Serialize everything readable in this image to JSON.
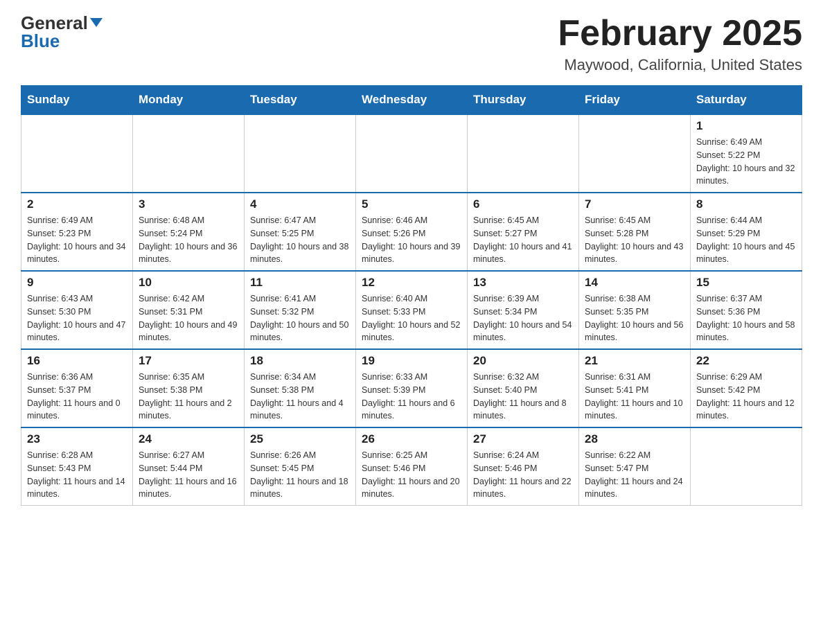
{
  "logo": {
    "general": "General",
    "arrow": "▶",
    "blue": "Blue"
  },
  "header": {
    "month_title": "February 2025",
    "location": "Maywood, California, United States"
  },
  "days_of_week": [
    "Sunday",
    "Monday",
    "Tuesday",
    "Wednesday",
    "Thursday",
    "Friday",
    "Saturday"
  ],
  "weeks": [
    {
      "days": [
        {
          "day": "",
          "sunrise": "",
          "sunset": "",
          "daylight": ""
        },
        {
          "day": "",
          "sunrise": "",
          "sunset": "",
          "daylight": ""
        },
        {
          "day": "",
          "sunrise": "",
          "sunset": "",
          "daylight": ""
        },
        {
          "day": "",
          "sunrise": "",
          "sunset": "",
          "daylight": ""
        },
        {
          "day": "",
          "sunrise": "",
          "sunset": "",
          "daylight": ""
        },
        {
          "day": "",
          "sunrise": "",
          "sunset": "",
          "daylight": ""
        },
        {
          "day": "1",
          "sunrise": "Sunrise: 6:49 AM",
          "sunset": "Sunset: 5:22 PM",
          "daylight": "Daylight: 10 hours and 32 minutes."
        }
      ]
    },
    {
      "days": [
        {
          "day": "2",
          "sunrise": "Sunrise: 6:49 AM",
          "sunset": "Sunset: 5:23 PM",
          "daylight": "Daylight: 10 hours and 34 minutes."
        },
        {
          "day": "3",
          "sunrise": "Sunrise: 6:48 AM",
          "sunset": "Sunset: 5:24 PM",
          "daylight": "Daylight: 10 hours and 36 minutes."
        },
        {
          "day": "4",
          "sunrise": "Sunrise: 6:47 AM",
          "sunset": "Sunset: 5:25 PM",
          "daylight": "Daylight: 10 hours and 38 minutes."
        },
        {
          "day": "5",
          "sunrise": "Sunrise: 6:46 AM",
          "sunset": "Sunset: 5:26 PM",
          "daylight": "Daylight: 10 hours and 39 minutes."
        },
        {
          "day": "6",
          "sunrise": "Sunrise: 6:45 AM",
          "sunset": "Sunset: 5:27 PM",
          "daylight": "Daylight: 10 hours and 41 minutes."
        },
        {
          "day": "7",
          "sunrise": "Sunrise: 6:45 AM",
          "sunset": "Sunset: 5:28 PM",
          "daylight": "Daylight: 10 hours and 43 minutes."
        },
        {
          "day": "8",
          "sunrise": "Sunrise: 6:44 AM",
          "sunset": "Sunset: 5:29 PM",
          "daylight": "Daylight: 10 hours and 45 minutes."
        }
      ]
    },
    {
      "days": [
        {
          "day": "9",
          "sunrise": "Sunrise: 6:43 AM",
          "sunset": "Sunset: 5:30 PM",
          "daylight": "Daylight: 10 hours and 47 minutes."
        },
        {
          "day": "10",
          "sunrise": "Sunrise: 6:42 AM",
          "sunset": "Sunset: 5:31 PM",
          "daylight": "Daylight: 10 hours and 49 minutes."
        },
        {
          "day": "11",
          "sunrise": "Sunrise: 6:41 AM",
          "sunset": "Sunset: 5:32 PM",
          "daylight": "Daylight: 10 hours and 50 minutes."
        },
        {
          "day": "12",
          "sunrise": "Sunrise: 6:40 AM",
          "sunset": "Sunset: 5:33 PM",
          "daylight": "Daylight: 10 hours and 52 minutes."
        },
        {
          "day": "13",
          "sunrise": "Sunrise: 6:39 AM",
          "sunset": "Sunset: 5:34 PM",
          "daylight": "Daylight: 10 hours and 54 minutes."
        },
        {
          "day": "14",
          "sunrise": "Sunrise: 6:38 AM",
          "sunset": "Sunset: 5:35 PM",
          "daylight": "Daylight: 10 hours and 56 minutes."
        },
        {
          "day": "15",
          "sunrise": "Sunrise: 6:37 AM",
          "sunset": "Sunset: 5:36 PM",
          "daylight": "Daylight: 10 hours and 58 minutes."
        }
      ]
    },
    {
      "days": [
        {
          "day": "16",
          "sunrise": "Sunrise: 6:36 AM",
          "sunset": "Sunset: 5:37 PM",
          "daylight": "Daylight: 11 hours and 0 minutes."
        },
        {
          "day": "17",
          "sunrise": "Sunrise: 6:35 AM",
          "sunset": "Sunset: 5:38 PM",
          "daylight": "Daylight: 11 hours and 2 minutes."
        },
        {
          "day": "18",
          "sunrise": "Sunrise: 6:34 AM",
          "sunset": "Sunset: 5:38 PM",
          "daylight": "Daylight: 11 hours and 4 minutes."
        },
        {
          "day": "19",
          "sunrise": "Sunrise: 6:33 AM",
          "sunset": "Sunset: 5:39 PM",
          "daylight": "Daylight: 11 hours and 6 minutes."
        },
        {
          "day": "20",
          "sunrise": "Sunrise: 6:32 AM",
          "sunset": "Sunset: 5:40 PM",
          "daylight": "Daylight: 11 hours and 8 minutes."
        },
        {
          "day": "21",
          "sunrise": "Sunrise: 6:31 AM",
          "sunset": "Sunset: 5:41 PM",
          "daylight": "Daylight: 11 hours and 10 minutes."
        },
        {
          "day": "22",
          "sunrise": "Sunrise: 6:29 AM",
          "sunset": "Sunset: 5:42 PM",
          "daylight": "Daylight: 11 hours and 12 minutes."
        }
      ]
    },
    {
      "days": [
        {
          "day": "23",
          "sunrise": "Sunrise: 6:28 AM",
          "sunset": "Sunset: 5:43 PM",
          "daylight": "Daylight: 11 hours and 14 minutes."
        },
        {
          "day": "24",
          "sunrise": "Sunrise: 6:27 AM",
          "sunset": "Sunset: 5:44 PM",
          "daylight": "Daylight: 11 hours and 16 minutes."
        },
        {
          "day": "25",
          "sunrise": "Sunrise: 6:26 AM",
          "sunset": "Sunset: 5:45 PM",
          "daylight": "Daylight: 11 hours and 18 minutes."
        },
        {
          "day": "26",
          "sunrise": "Sunrise: 6:25 AM",
          "sunset": "Sunset: 5:46 PM",
          "daylight": "Daylight: 11 hours and 20 minutes."
        },
        {
          "day": "27",
          "sunrise": "Sunrise: 6:24 AM",
          "sunset": "Sunset: 5:46 PM",
          "daylight": "Daylight: 11 hours and 22 minutes."
        },
        {
          "day": "28",
          "sunrise": "Sunrise: 6:22 AM",
          "sunset": "Sunset: 5:47 PM",
          "daylight": "Daylight: 11 hours and 24 minutes."
        },
        {
          "day": "",
          "sunrise": "",
          "sunset": "",
          "daylight": ""
        }
      ]
    }
  ]
}
